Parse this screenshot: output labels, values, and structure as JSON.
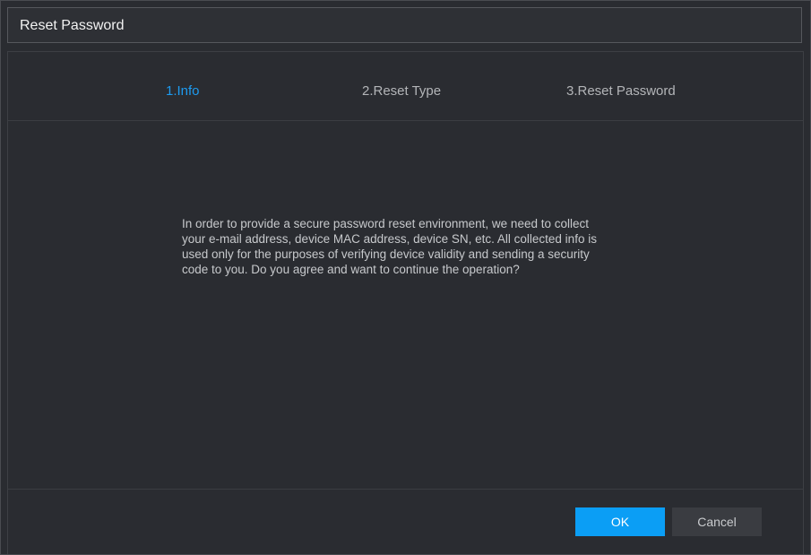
{
  "dialog": {
    "title": "Reset Password"
  },
  "steps": [
    {
      "label": "1.Info",
      "active": true
    },
    {
      "label": "2.Reset Type",
      "active": false
    },
    {
      "label": "3.Reset Password",
      "active": false
    }
  ],
  "info": {
    "line1": "In order to provide a secure password reset environment, we need to collect",
    "line2": "your e-mail address, device MAC address, device SN, etc. All collected info is",
    "line3": "used only for the purposes of verifying device validity and sending a security",
    "line4": "code to you. Do you agree and want to continue the operation?"
  },
  "buttons": {
    "ok_label": "OK",
    "cancel_label": "Cancel"
  },
  "colors": {
    "accent": "#0b9ef5",
    "active_step": "#1d9bf0",
    "background": "#2a2c31"
  }
}
